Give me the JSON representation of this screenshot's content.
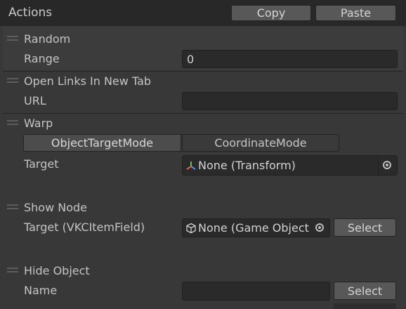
{
  "header": {
    "title": "Actions",
    "copy_label": "Copy",
    "paste_label": "Paste"
  },
  "random": {
    "title": "Random",
    "range_label": "Range",
    "range_value": "0"
  },
  "open_links": {
    "title": "Open Links In New Tab",
    "url_label": "URL",
    "url_value": ""
  },
  "warp": {
    "title": "Warp",
    "tabs": [
      "ObjectTargetMode",
      "CoordinateMode"
    ],
    "active_tab": "ObjectTargetMode",
    "target_label": "Target",
    "target_value": "None (Transform)",
    "target_icon": "transform-icon"
  },
  "show_node": {
    "title": "Show Node",
    "target_label": "Target (VKCItemField)",
    "target_value": "None (Game Object)",
    "target_icon": "gameobject-icon",
    "select_label": "Select"
  },
  "hide_object": {
    "title": "Hide Object",
    "name_label": "Name",
    "name_value": "",
    "select_label": "Select"
  }
}
